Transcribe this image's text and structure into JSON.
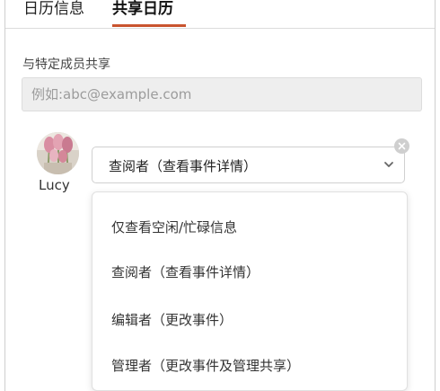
{
  "tabs": {
    "calendar_info": "日历信息",
    "shared_calendar": "共享日历",
    "accent_color": "#c9542f"
  },
  "share": {
    "section_label": "与特定成员共享",
    "email_placeholder": "例如:abc@example.com"
  },
  "member": {
    "name": "Lucy",
    "selected_role": "查阅者（查看事件详情）"
  },
  "role_options": [
    "仅查看空闲/忙碌信息",
    "查阅者（查看事件详情）",
    "编辑者（更改事件）",
    "管理者（更改事件及管理共享）"
  ]
}
